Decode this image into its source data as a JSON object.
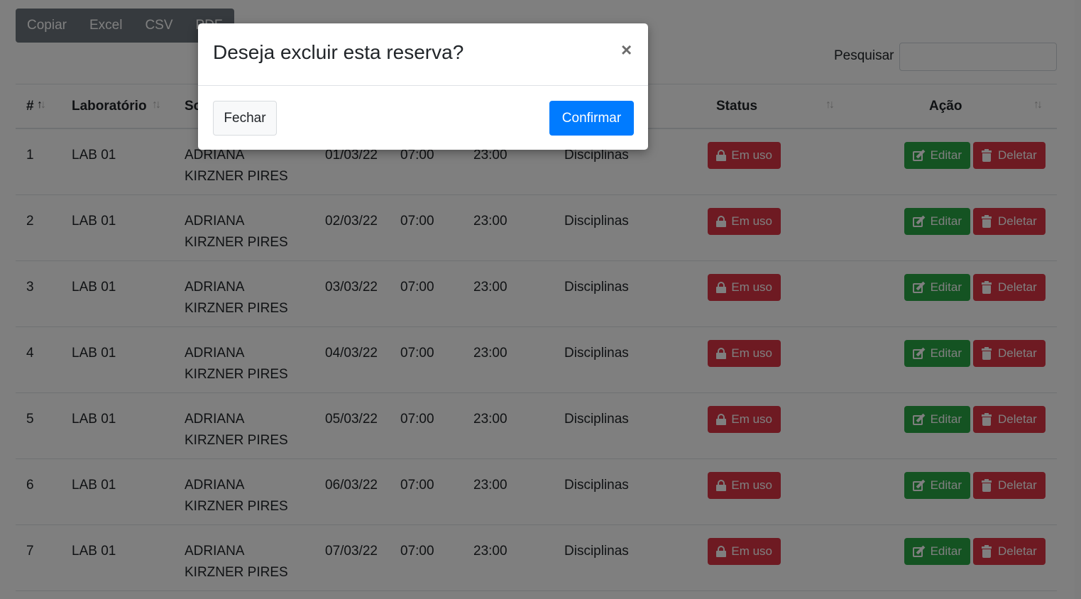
{
  "export": {
    "buttons": [
      "Copiar",
      "Excel",
      "CSV",
      "PDF"
    ]
  },
  "search": {
    "label": "Pesquisar",
    "value": ""
  },
  "table": {
    "headers": {
      "num": "#",
      "lab": "Laboratório",
      "solicitante": "Solicitante",
      "status": "Status",
      "acao": "Ação"
    },
    "rows": [
      {
        "num": "1",
        "lab": "LAB 01",
        "name": "ADRIANA KIRZNER PIRES",
        "date": "01/03/22",
        "start": "07:00",
        "end": "23:00",
        "type": "Disciplinas",
        "status": "Em uso",
        "edit": "Editar",
        "delete": "Deletar"
      },
      {
        "num": "2",
        "lab": "LAB 01",
        "name": "ADRIANA KIRZNER PIRES",
        "date": "02/03/22",
        "start": "07:00",
        "end": "23:00",
        "type": "Disciplinas",
        "status": "Em uso",
        "edit": "Editar",
        "delete": "Deletar"
      },
      {
        "num": "3",
        "lab": "LAB 01",
        "name": "ADRIANA KIRZNER PIRES",
        "date": "03/03/22",
        "start": "07:00",
        "end": "23:00",
        "type": "Disciplinas",
        "status": "Em uso",
        "edit": "Editar",
        "delete": "Deletar"
      },
      {
        "num": "4",
        "lab": "LAB 01",
        "name": "ADRIANA KIRZNER PIRES",
        "date": "04/03/22",
        "start": "07:00",
        "end": "23:00",
        "type": "Disciplinas",
        "status": "Em uso",
        "edit": "Editar",
        "delete": "Deletar"
      },
      {
        "num": "5",
        "lab": "LAB 01",
        "name": "ADRIANA KIRZNER PIRES",
        "date": "05/03/22",
        "start": "07:00",
        "end": "23:00",
        "type": "Disciplinas",
        "status": "Em uso",
        "edit": "Editar",
        "delete": "Deletar"
      },
      {
        "num": "6",
        "lab": "LAB 01",
        "name": "ADRIANA KIRZNER PIRES",
        "date": "06/03/22",
        "start": "07:00",
        "end": "23:00",
        "type": "Disciplinas",
        "status": "Em uso",
        "edit": "Editar",
        "delete": "Deletar"
      },
      {
        "num": "7",
        "lab": "LAB 01",
        "name": "ADRIANA KIRZNER PIRES",
        "date": "07/03/22",
        "start": "07:00",
        "end": "23:00",
        "type": "Disciplinas",
        "status": "Em uso",
        "edit": "Editar",
        "delete": "Deletar"
      }
    ]
  },
  "modal": {
    "title": "Deseja excluir esta reserva?",
    "close_symbol": "×",
    "cancel_label": "Fechar",
    "confirm_label": "Confirmar"
  },
  "icons": {
    "status": "lock-icon",
    "edit": "edit-icon",
    "delete": "trash-icon",
    "sort": "sort-arrows-icon"
  },
  "colors": {
    "primary": "#007bff",
    "success": "#28a745",
    "danger": "#dc3545",
    "secondary": "#6c757d"
  }
}
